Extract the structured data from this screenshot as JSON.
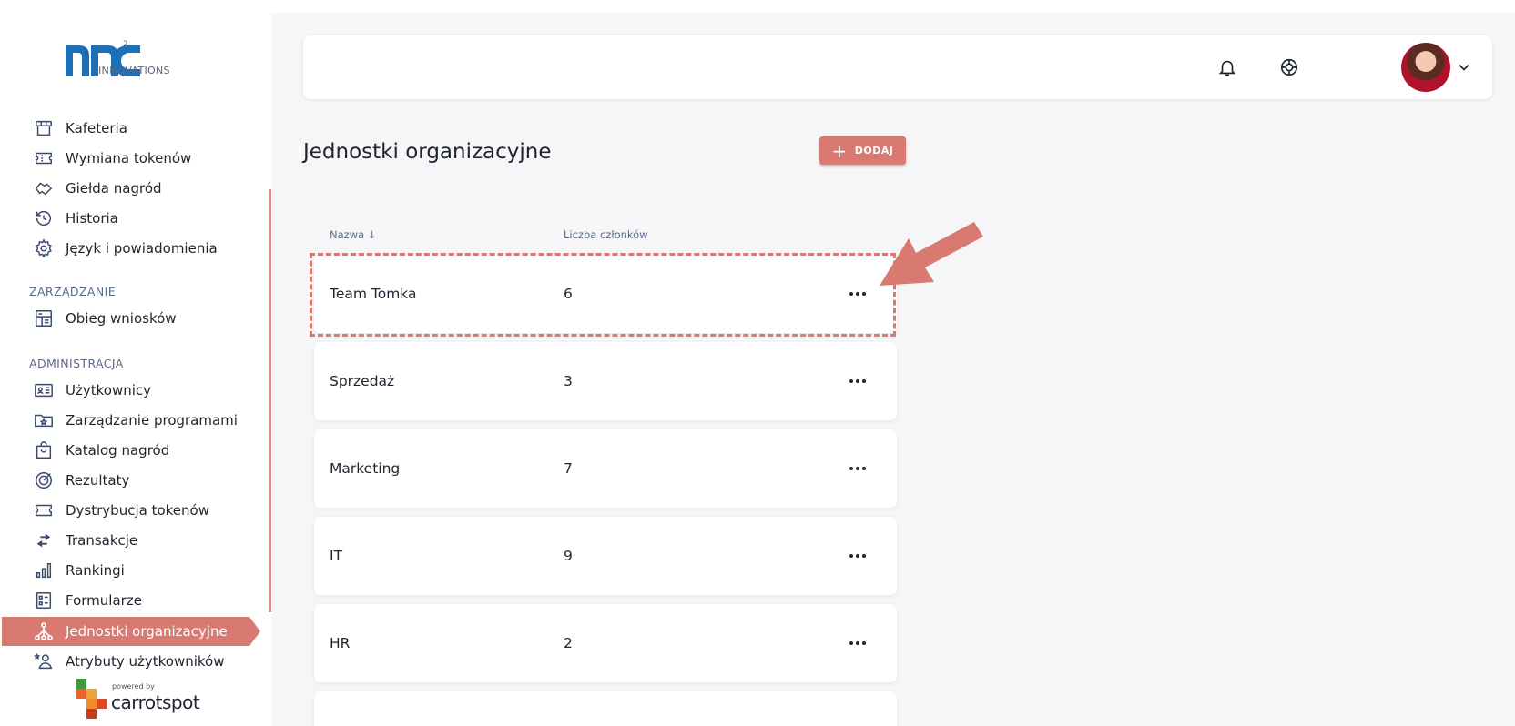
{
  "brand": {
    "logo_text": "INNOVATIONS",
    "superscript": "2"
  },
  "nav": {
    "items": [
      {
        "label": "Kafeteria",
        "icon": "store-icon"
      },
      {
        "label": "Wymiana tokenów",
        "icon": "ticket-icon"
      },
      {
        "label": "Giełda nagród",
        "icon": "handshake-icon"
      },
      {
        "label": "Historia",
        "icon": "history-icon"
      },
      {
        "label": "Język i powiadomienia",
        "icon": "gear-icon"
      }
    ],
    "section_zarzadzanie": "ZARZĄDZANIE",
    "zarzadzanie_items": [
      {
        "label": "Obieg wniosków",
        "icon": "workflow-icon"
      }
    ],
    "section_administracja": "ADMINISTRACJA",
    "administracja_items": [
      {
        "label": "Użytkownicy",
        "icon": "id-card-icon"
      },
      {
        "label": "Zarządzanie programami",
        "icon": "folder-star-icon"
      },
      {
        "label": "Katalog nagród",
        "icon": "shopping-bag-icon"
      },
      {
        "label": "Rezultaty",
        "icon": "target-icon"
      },
      {
        "label": "Dystrybucja tokenów",
        "icon": "ticket-icon"
      },
      {
        "label": "Transakcje",
        "icon": "transfer-icon"
      },
      {
        "label": "Rankingi",
        "icon": "bar-chart-icon"
      },
      {
        "label": "Formularze",
        "icon": "form-icon"
      }
    ],
    "active": {
      "label": "Jednostki organizacyjne",
      "icon": "org-tree-icon"
    },
    "after_active": {
      "label": "Atrybuty użytkowników",
      "icon": "user-star-icon"
    }
  },
  "powered": {
    "by": "powered by",
    "brand": "carrotspot"
  },
  "header": {
    "icons": [
      "bell-icon",
      "lifebuoy-icon"
    ],
    "avatar": "avatar",
    "chevron": "chevron-down-icon"
  },
  "page": {
    "title": "Jednostki organizacyjne",
    "add_label": "DODAJ"
  },
  "table": {
    "col_name": "Nazwa ↓",
    "col_members": "Liczba członków",
    "rows": [
      {
        "name": "Team Tomka",
        "count": "6"
      },
      {
        "name": "Sprzedaż",
        "count": "3"
      },
      {
        "name": "Marketing",
        "count": "7"
      },
      {
        "name": "IT",
        "count": "9"
      },
      {
        "name": "HR",
        "count": "2"
      }
    ]
  },
  "colors": {
    "accent": "#d87a72",
    "text": "#1f2430",
    "muted": "#5a6b8c",
    "background": "#f6f6f8"
  }
}
